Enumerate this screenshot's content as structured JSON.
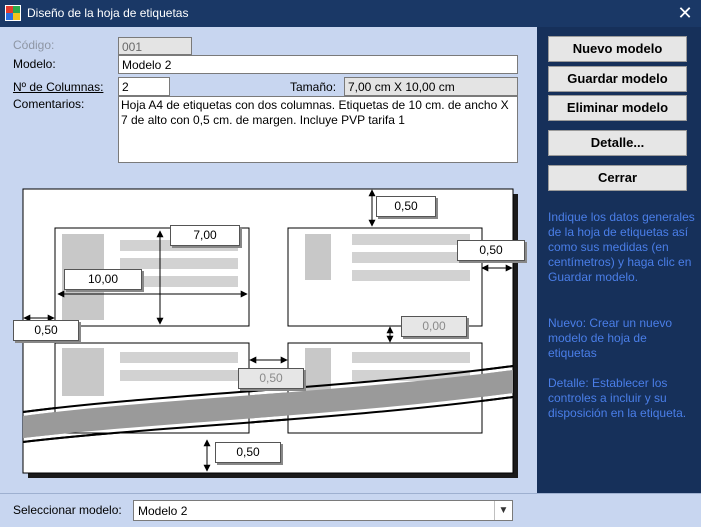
{
  "window": {
    "title": "Diseño de la hoja de etiquetas",
    "icon": "app-grid-icon",
    "close_icon": "close-icon"
  },
  "form": {
    "codigo": {
      "label": "Código:",
      "value": "001"
    },
    "modelo": {
      "label": "Modelo:",
      "value": "Modelo 2"
    },
    "columnas": {
      "label": "Nº de Columnas:",
      "value": "2"
    },
    "tamano": {
      "label": "Tamaño:",
      "value": "7,00 cm X 10,00 cm"
    },
    "comentarios": {
      "label": "Comentarios:",
      "value": "Hoja A4 de etiquetas con dos columnas. Etiquetas de 10 cm. de ancho X 7 de alto con 0,5 cm. de margen. Incluye PVP tarifa 1"
    }
  },
  "diagram": {
    "margin_top": "0,50",
    "label_height": "7,00",
    "label_width": "10,00",
    "margin_right": "0,50",
    "margin_left": "0,50",
    "vertical_gap": "0,00",
    "horizontal_gap": "0,50",
    "margin_bottom": "0,50"
  },
  "buttons": {
    "nuevo": "Nuevo modelo",
    "guardar": "Guardar modelo",
    "eliminar": "Eliminar modelo",
    "detalle": "Detalle...",
    "cerrar": "Cerrar"
  },
  "help": {
    "p1": "Indique los datos generales de la hoja de etiquetas así como sus medidas (en centímetros) y haga clic en Guardar modelo.",
    "p2": "Nuevo: Crear un nuevo modelo de hoja de etiquetas",
    "p3": "Detalle: Establecer los controles a incluir y su disposición en la etiqueta."
  },
  "bottom": {
    "label": "Seleccionar modelo:",
    "value": "Modelo 2",
    "dropdown_icon": "chevron-down-icon"
  },
  "colors": {
    "title_bar": "#1a3866",
    "form_background": "#c8d6f0",
    "side_panel": "#16305a",
    "help_text": "#4a7ee8"
  }
}
